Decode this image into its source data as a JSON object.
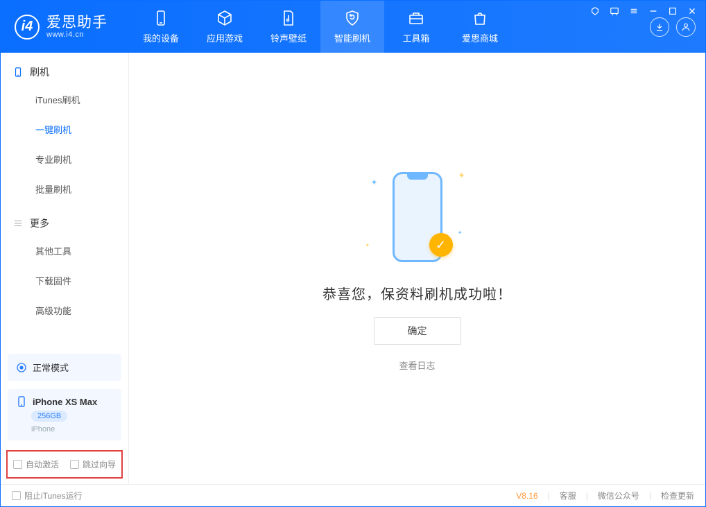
{
  "brand": {
    "title": "爱思助手",
    "subtitle": "www.i4.cn"
  },
  "tabs": {
    "device": "我的设备",
    "apps": "应用游戏",
    "ringtone": "铃声壁纸",
    "flash": "智能刷机",
    "toolbox": "工具箱",
    "store": "爱思商城"
  },
  "sidebar": {
    "group_flash": "刷机",
    "items_flash": {
      "itunes": "iTunes刷机",
      "oneclick": "一键刷机",
      "pro": "专业刷机",
      "batch": "批量刷机"
    },
    "group_more": "更多",
    "items_more": {
      "other": "其他工具",
      "firmware": "下载固件",
      "advanced": "高级功能"
    }
  },
  "mode": {
    "label": "正常模式"
  },
  "device": {
    "name": "iPhone XS Max",
    "storage": "256GB",
    "type": "iPhone"
  },
  "options": {
    "auto_activate": "自动激活",
    "skip_guide": "跳过向导"
  },
  "main": {
    "success": "恭喜您，保资料刷机成功啦！",
    "ok": "确定",
    "view_log": "查看日志"
  },
  "footer": {
    "block_itunes": "阻止iTunes运行",
    "version": "V8.16",
    "support": "客服",
    "wechat": "微信公众号",
    "update": "检查更新"
  }
}
